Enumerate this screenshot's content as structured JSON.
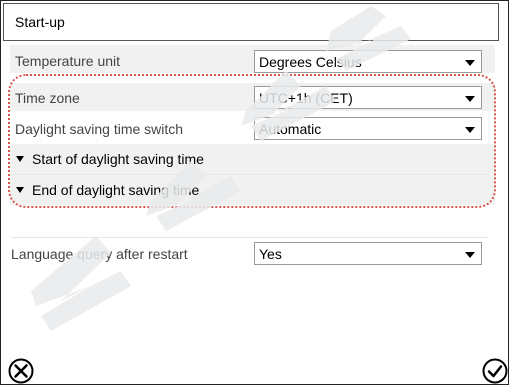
{
  "title": "Start-up",
  "rows": [
    {
      "label": "Temperature unit",
      "value": "Degrees Celsius"
    },
    {
      "label": "Time zone",
      "value": "UTC+1h (CET)"
    },
    {
      "label": "Daylight saving time switch",
      "value": "Automatic"
    },
    {
      "label": "Language query after restart",
      "value": "Yes"
    }
  ],
  "expanders": [
    {
      "label": "Start of daylight saving time"
    },
    {
      "label": "End of daylight saving time"
    }
  ],
  "icons": {
    "cancel": "cancel-circle-x-icon",
    "confirm": "confirm-circle-check-icon"
  },
  "watermark": "MMM",
  "colors": {
    "highlight": "#d9534f",
    "row_background": "#f1f1f1",
    "watermark": "#e8eaec"
  }
}
